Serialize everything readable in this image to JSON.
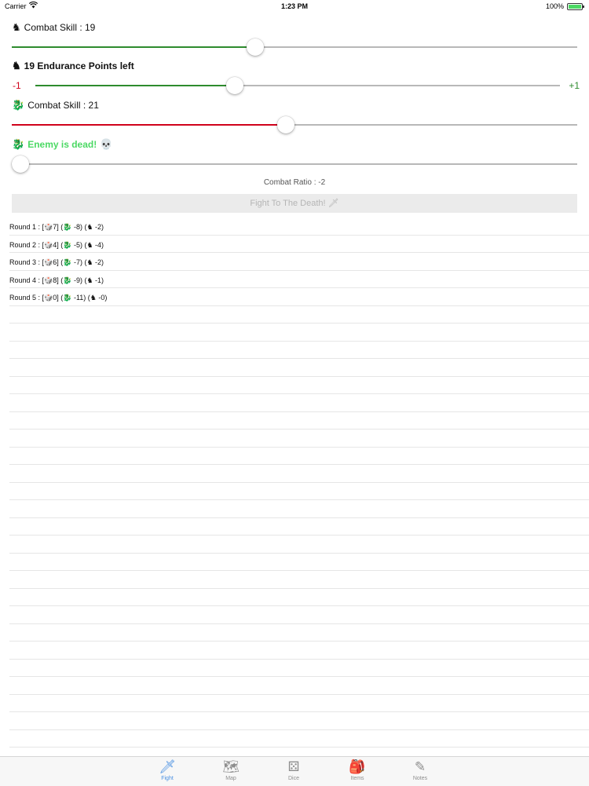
{
  "status_bar": {
    "carrier": "Carrier",
    "time": "1:23 PM",
    "battery": "100%",
    "battery_level": 1.0
  },
  "player_skill": {
    "icon": "knight-icon",
    "glyph": "♞",
    "label": "Combat Skill : 19",
    "value": 19,
    "slider_fraction": 0.43,
    "fill_color": "#2e8b2e"
  },
  "player_endurance": {
    "icon": "knight-icon",
    "glyph": "♞",
    "label": "19 Endurance Points left",
    "minus_label": "-1",
    "plus_label": "+1",
    "slider_fraction": 0.38,
    "fill_color": "#2e8b2e"
  },
  "enemy_skill": {
    "icon": "dragon-icon",
    "glyph": "🐉",
    "label": "Combat Skill : 21",
    "value": 21,
    "slider_fraction": 0.485,
    "fill_color": "#d0021b"
  },
  "enemy_status": {
    "icon": "dragon-icon",
    "glyph": "🐉",
    "label": "Enemy is dead!",
    "skull_icon": "skull-icon",
    "skull_glyph": "💀",
    "slider_fraction": 0.0,
    "color": "#4cd964"
  },
  "combat_ratio": "Combat Ratio : -2",
  "fight_button": {
    "label": "Fight To The Death!",
    "icon": "sword-icon",
    "glyph": "🗡"
  },
  "rounds": [
    {
      "label": "Round 1 : [🎲7] (🐉 -8) (♞ -2)"
    },
    {
      "label": "Round 2 : [🎲4] (🐉 -5) (♞ -4)"
    },
    {
      "label": "Round 3 : [🎲6] (🐉 -7) (♞ -2)"
    },
    {
      "label": "Round 4 : [🎲8] (🐉 -9) (♞ -1)"
    },
    {
      "label": "Round 5 : [🎲0] (🐉 -11) (♞ -0)"
    }
  ],
  "tabs": [
    {
      "label": "Fight",
      "icon": "sword-icon",
      "glyph": "🗡",
      "active": true
    },
    {
      "label": "Map",
      "icon": "map-icon",
      "glyph": "🗺",
      "active": false
    },
    {
      "label": "Dice",
      "icon": "dice-icon",
      "glyph": "⚄",
      "active": false
    },
    {
      "label": "Items",
      "icon": "backpack-icon",
      "glyph": "🎒",
      "active": false
    },
    {
      "label": "Notes",
      "icon": "quill-icon",
      "glyph": "✎",
      "active": false
    }
  ],
  "colors": {
    "accent": "#4a90e2",
    "green": "#2e8b2e",
    "red": "#d0021b",
    "alive_green": "#4cd964"
  }
}
